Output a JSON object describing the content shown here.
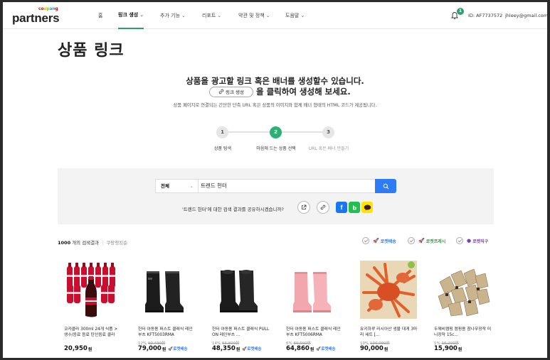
{
  "header": {
    "logo_small": "coupang",
    "logo_main": "partners",
    "nav": [
      {
        "label": "홈",
        "chevron": false,
        "active": false
      },
      {
        "label": "링크 생성",
        "chevron": true,
        "active": true
      },
      {
        "label": "추가 기능",
        "chevron": true,
        "active": false
      },
      {
        "label": "리포트",
        "chevron": true,
        "active": false
      },
      {
        "label": "약관 및 정책",
        "chevron": true,
        "active": false
      },
      {
        "label": "도움말",
        "chevron": true,
        "active": false
      }
    ],
    "notification_count": "1",
    "user_id": "ID: AF7737572",
    "email": "jhleey@gmail.com"
  },
  "page_title": "상품 링크",
  "intro": {
    "line1": "상품을 광고할 링크 혹은 배너를 생성할수 있습니다.",
    "button_label": "링크 생성",
    "line2_suffix": "을 클릭하여 생성해 보세요.",
    "line3": "상품 페이지로 연결되는 간단한 단축 URL 혹은 상품의 이미지와 함께 배너 형태의 HTML 코드가 제공됩니다."
  },
  "steps": [
    {
      "num": "1",
      "label": "상품 탐색",
      "state": "done"
    },
    {
      "num": "2",
      "label": "마음에 드는 상품 선택",
      "state": "current"
    },
    {
      "num": "3",
      "label": "URL 혹은 배너 만들기",
      "state": "todo"
    }
  ],
  "search": {
    "category": "전체",
    "query": "트렌드 헌터",
    "share_question": "'트렌드 헌터'에 대한 검색 결과를 공유하시겠습니까?"
  },
  "results": {
    "count": "1000",
    "count_suffix": "개의 검색결과",
    "link": "쿠팡랭킹순",
    "filters": [
      "로켓배송",
      "로켓프레시",
      "로켓직구"
    ]
  },
  "colors": {
    "accent_green": "#2eaf74",
    "search_blue": "#2e7bf6",
    "rocket_fresh": "#2e9e3e",
    "rocket_global": "#7b3fbf"
  },
  "products": [
    {
      "name": "코카콜라 300ml 24개 식품 > 생수/음료 음료 탄산음료 콜라",
      "discount": "",
      "old_price": "",
      "price": "20,950",
      "won": "원",
      "rocket": ""
    },
    {
      "name": "헌터 아동용 퍼스트 클래식 레인부츠 KFT5003RMA",
      "discount": "12%",
      "old_price": "90,430원",
      "price": "79,000",
      "won": "원",
      "rocket": "로켓배송"
    },
    {
      "name": "헌터 아동용 퍼스트 클래식 PULL ON 레인부츠 ...",
      "discount": "14%",
      "old_price": "56,800원",
      "price": "48,350",
      "won": "원",
      "rocket": "로켓배송"
    },
    {
      "name": "헌터 아동용 퍼스트 클래식 레인부츠 KFT5006RMA",
      "discount": "6%",
      "old_price": "69,000원",
      "price": "64,860",
      "won": "원",
      "rocket": "로켓배송"
    },
    {
      "name": "유키하루 러시아산 생물 대게 3마리 세트 [...",
      "discount": "10%",
      "old_price": "100,000원",
      "price": "90,000",
      "won": "원",
      "rocket": ""
    },
    {
      "name": "두께비캠핑 캠핑용 참나무장작 미니장작 15c...",
      "discount": "1%",
      "old_price": "16,200원",
      "price": "15,900",
      "won": "원",
      "rocket": ""
    }
  ]
}
